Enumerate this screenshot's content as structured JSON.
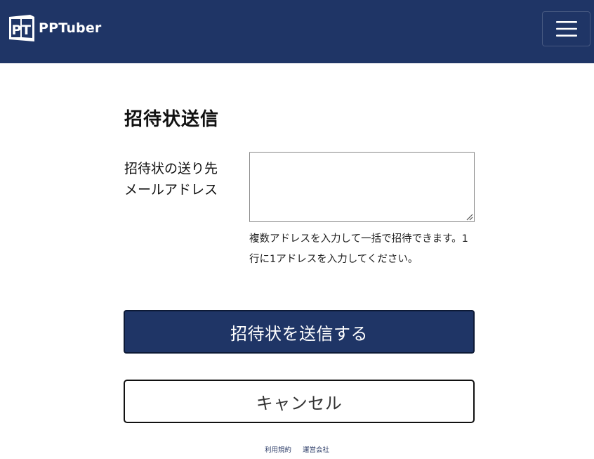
{
  "header": {
    "logo_text": "PPTuber",
    "logo_mark_letters": "PT",
    "background_color": "#1f3566",
    "menu_icon": "hamburger-menu-icon"
  },
  "page": {
    "title": "招待状送信"
  },
  "form": {
    "label_line1": "招待状の送り先",
    "label_line2": "メールアドレス",
    "textarea_value": "",
    "help_text": "複数アドレスを入力して一括で招待できます。1行に1アドレスを入力してください。"
  },
  "actions": {
    "submit_label": "招待状を送信する",
    "cancel_label": "キャンセル",
    "submit_color": "#1f3566"
  },
  "footer": {
    "links": [
      "利用規約",
      "運営会社"
    ]
  }
}
